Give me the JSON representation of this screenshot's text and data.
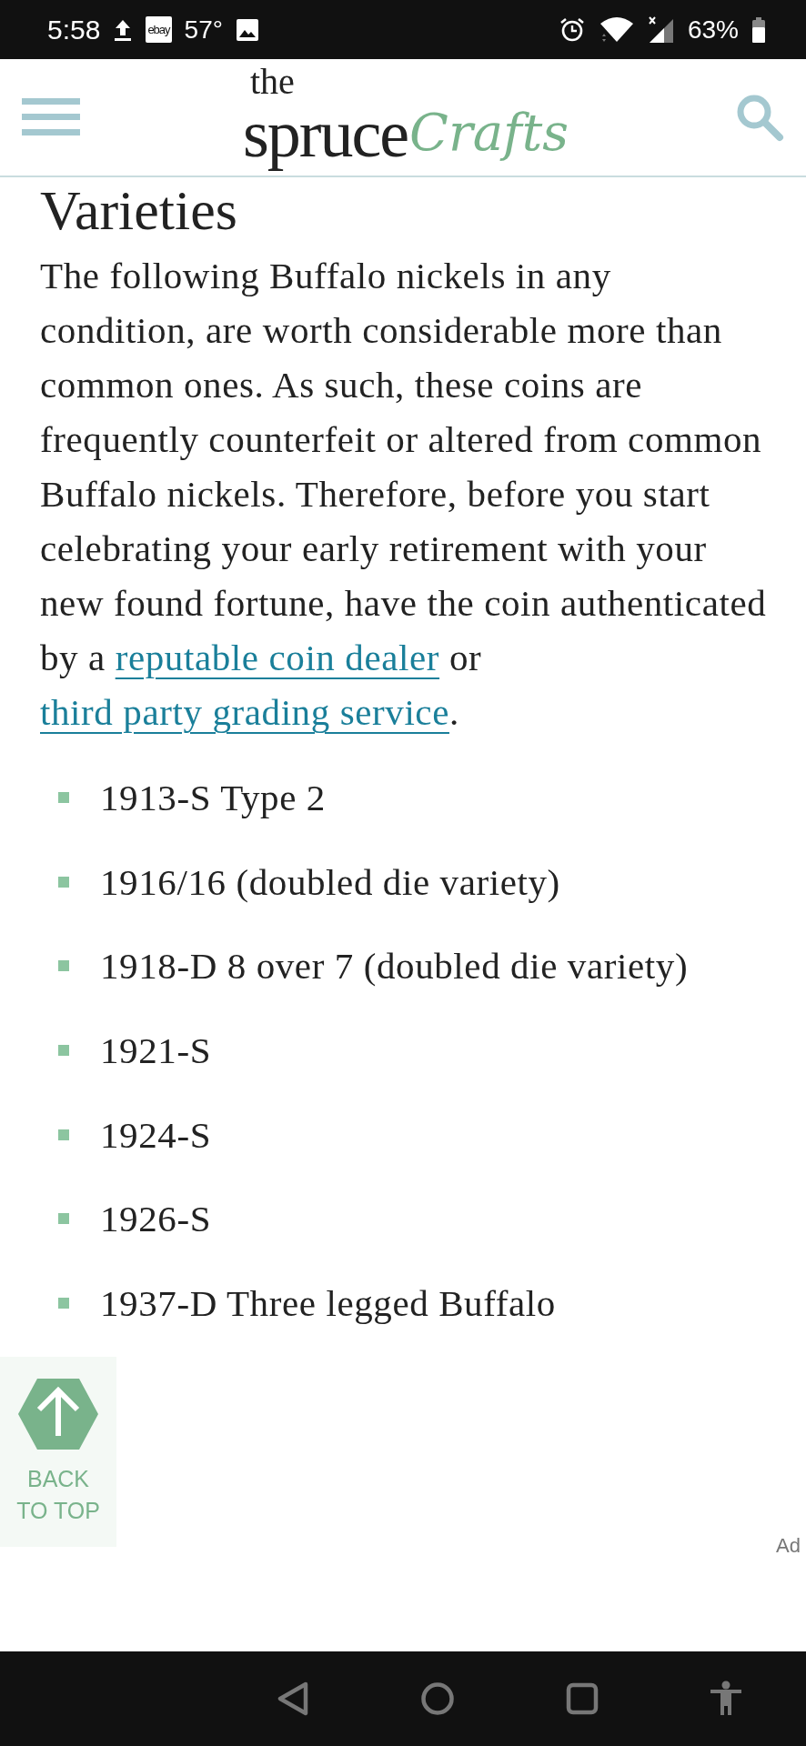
{
  "status_bar": {
    "time": "5:58",
    "notification_badge": "ebay",
    "temperature": "57°",
    "battery": "63%"
  },
  "header": {
    "logo": {
      "line_1": "the",
      "line_2": "spruce",
      "script": "Crafts"
    }
  },
  "article": {
    "heading": "Varieties",
    "paragraph": [
      {
        "kind": "text",
        "text": "The following Buffalo nickels in any condition, are worth considerable more than common ones. As such, these coins are frequently counterfeit or altered from common Buffalo nickels. Therefore, before you start celebrating your early retirement with your new found fortune, have the coin authenticated by a "
      },
      {
        "kind": "link",
        "text": "reputable coin dealer"
      },
      {
        "kind": "text",
        "text": " or "
      },
      {
        "kind": "link",
        "text": "third party grading service"
      },
      {
        "kind": "text",
        "text": "."
      }
    ],
    "list": [
      "1913-S Type 2",
      "1916/16 (doubled die variety)",
      "1918-D 8 over 7 (doubled die variety)",
      "1921-S",
      "1924-S",
      "1926-S",
      "1937-D Three legged Buffalo"
    ]
  },
  "back_to_top": {
    "label": "BACK TO TOP"
  },
  "ad_label": "Ad"
}
